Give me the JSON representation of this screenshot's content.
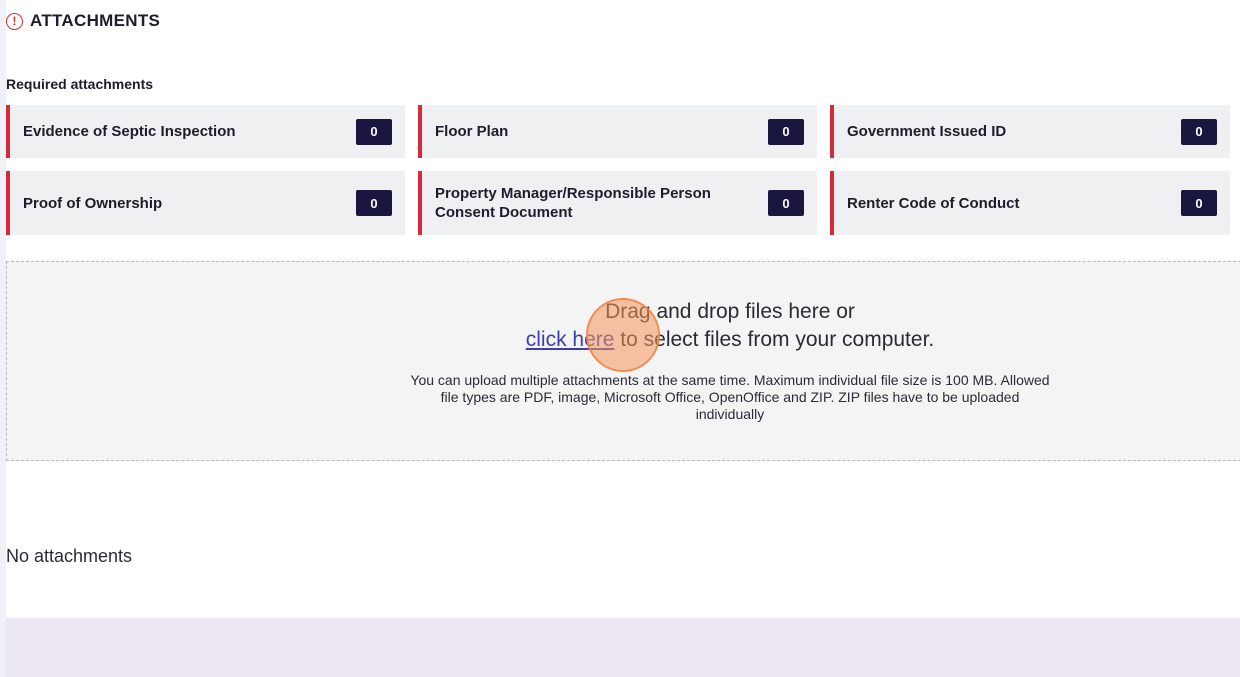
{
  "section": {
    "title": "ATTACHMENTS",
    "icon": "exclamation-circle-icon",
    "icon_glyph": "!",
    "icon_color": "#d0342c"
  },
  "required": {
    "label": "Required attachments",
    "items": [
      {
        "label": "Evidence of Septic Inspection",
        "count": "0"
      },
      {
        "label": "Floor Plan",
        "count": "0"
      },
      {
        "label": "Government Issued ID",
        "count": "0"
      },
      {
        "label": "Proof of Ownership",
        "count": "0"
      },
      {
        "label": "Property Manager/Responsible Person Consent Document",
        "count": "0"
      },
      {
        "label": "Renter Code of Conduct",
        "count": "0"
      }
    ]
  },
  "dropzone": {
    "line1": "Drag and drop files here or",
    "link": "click here",
    "line2_rest": " to select files from your computer.",
    "note": "You can upload multiple attachments at the same time. Maximum individual file size is 100 MB. Allowed file types are PDF, image, Microsoft Office, OpenOffice and ZIP. ZIP files have to be uploaded individually"
  },
  "empty_state": "No attachments",
  "colors": {
    "accent_red": "#d62a3a",
    "badge_navy": "#19163f",
    "link_blue": "#3b3fb3",
    "footer_lavender": "#ede6f3"
  }
}
